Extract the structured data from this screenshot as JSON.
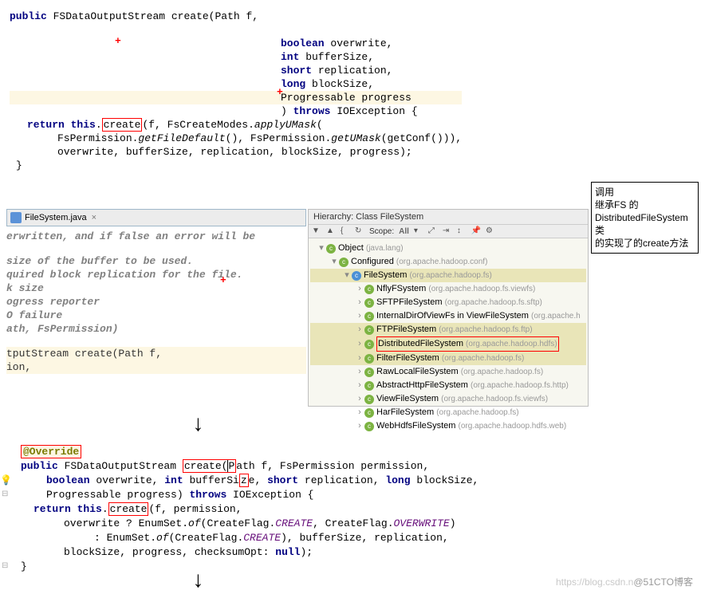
{
  "top": {
    "l1_kw": "public",
    "l1_type": "FSDataOutputStream",
    "l1_name": "create(Path f,",
    "l2": "boolean",
    "l2b": " overwrite,",
    "l3": "int",
    "l3b": " bufferSize,",
    "l4": "short",
    "l4b": " replication,",
    "l5": "long",
    "l5b": " blockSize,",
    "l6": "Progressable progress",
    "l7a": ") ",
    "l7b": "throws",
    "l7c": " IOException {",
    "l8a": "return this",
    "l8b": ".",
    "l8_create": "create",
    "l8c": "(f, FsCreateModes.",
    "l8d": "applyUMask",
    "l8e": "(",
    "l9a": "FsPermission.",
    "l9b": "getFileDefault",
    "l9c": "(), FsPermission.",
    "l9d": "getUMask",
    "l9e": "(getConf())),",
    "l10": "overwrite, bufferSize, replication, blockSize, progress);",
    "l11": "}"
  },
  "tab": {
    "filename": "FileSystem.java",
    "close": "×"
  },
  "mid": {
    "c1": "erwritten, and if false an error will be",
    "c2": " size of the buffer to be used.",
    "c3": "quired block replication for the file.",
    "c4": "k size",
    "c5": "ogress reporter",
    "c6": "O failure",
    "c7": "ath, FsPermission)",
    "sig1": "tputStream create(Path f,",
    "sig2": "ion,"
  },
  "hierarchy": {
    "title": "Hierarchy: Class FileSystem",
    "scope_label": "Scope:",
    "scope_value": "All",
    "root": "Object",
    "root_pkg": "(java.lang)",
    "conf": "Configured",
    "conf_pkg": "(org.apache.hadoop.conf)",
    "fs": "FileSystem",
    "fs_pkg": "(org.apache.hadoop.fs)",
    "items": [
      {
        "name": "NflyFSystem",
        "pkg": "(org.apache.hadoop.fs.viewfs)"
      },
      {
        "name": "SFTPFileSystem",
        "pkg": "(org.apache.hadoop.fs.sftp)"
      },
      {
        "name": "InternalDirOfViewFs in ViewFileSystem",
        "pkg": "(org.apache.h"
      },
      {
        "name": "FTPFileSystem",
        "pkg": "(org.apache.hadoop.fs.ftp)"
      },
      {
        "name": "DistributedFileSystem",
        "pkg": "(org.apache.hadoop.hdfs)"
      },
      {
        "name": "FilterFileSystem",
        "pkg": "(org.apache.hadoop.fs)"
      },
      {
        "name": "RawLocalFileSystem",
        "pkg": "(org.apache.hadoop.fs)"
      },
      {
        "name": "AbstractHttpFileSystem",
        "pkg": "(org.apache.hadoop.fs.http)"
      },
      {
        "name": "ViewFileSystem",
        "pkg": "(org.apache.hadoop.fs.viewfs)"
      },
      {
        "name": "HarFileSystem",
        "pkg": "(org.apache.hadoop.fs)"
      },
      {
        "name": "WebHdfsFileSystem",
        "pkg": "(org.apache.hadoop.hdfs.web)"
      }
    ]
  },
  "callout": {
    "l1": "调用",
    "l2": "继承FS 的",
    "l3": "DistributedFileSystem 类",
    "l4": "的实现了的create方法"
  },
  "bottom": {
    "override": "@Override",
    "l1a": "public",
    "l1b": " FSDataOutputStream ",
    "l1_create": "create",
    "l1c": "(",
    "l1d": "P",
    "l1e": "ath f, FsPermission permission,",
    "l2a": "boolean",
    "l2b": " overwrite, ",
    "l2c": "int",
    "l2d": " bufferSi",
    "l2e": "z",
    "l2f": "e, ",
    "l2g": "short",
    "l2h": " replication, ",
    "l2i": "long",
    "l2j": " blockSize,",
    "l3a": "Progressable progress) ",
    "l3b": "throws",
    "l3c": " IOException {",
    "l4a": "return this",
    "l4b": ".",
    "l4_create": "create",
    "l4c": "(f, permission,",
    "l5a": "overwrite ? EnumSet.",
    "l5b": "of",
    "l5c": "(CreateFlag.",
    "l5d": "CREATE",
    "l5e": ", CreateFlag.",
    "l5f": "OVERWRITE",
    "l5g": ")",
    "l6a": ": EnumSet.",
    "l6b": "of",
    "l6c": "(CreateFlag.",
    "l6d": "CREATE",
    "l6e": "), bufferSize, replication,",
    "l7": "blockSize, progress,  checksumOpt:",
    "l7b": "null",
    "l7c": ");",
    "l8": "}"
  },
  "watermark": {
    "left": "https://blog.csdn.n",
    "right": "@51CTO博客"
  },
  "red_plus": "+"
}
